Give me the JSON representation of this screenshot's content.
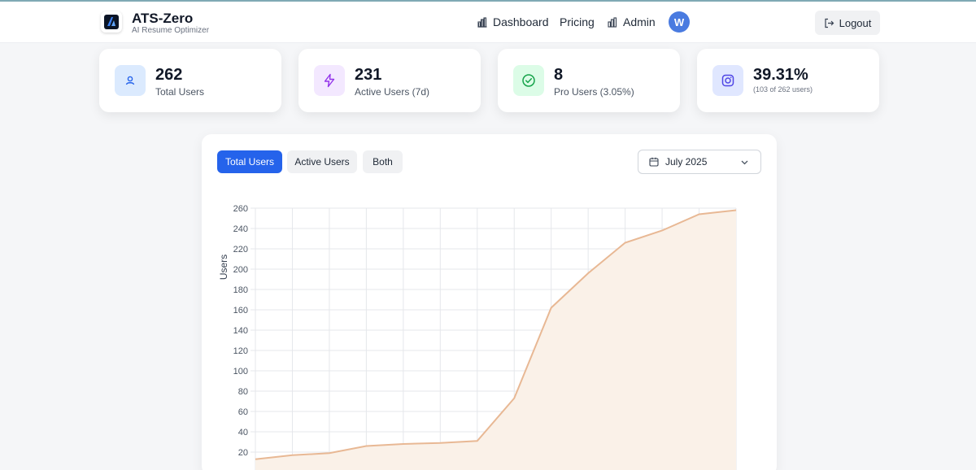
{
  "header": {
    "brand_title": "ATS-Zero",
    "brand_subtitle": "AI Resume Optimizer",
    "nav": [
      {
        "label": "Dashboard",
        "icon": "bar-chart-icon"
      },
      {
        "label": "Pricing"
      },
      {
        "label": "Admin",
        "icon": "bar-chart-icon"
      }
    ],
    "avatar_initial": "W",
    "logout_label": "Logout"
  },
  "stats": [
    {
      "value": "262",
      "label": "Total Users",
      "icon": "user-icon",
      "icon_color": "#2563eb",
      "icon_bg": "#dbeafe"
    },
    {
      "value": "231",
      "label": "Active Users (7d)",
      "icon": "lightning-icon",
      "icon_color": "#9333ea",
      "icon_bg": "#f3e8ff"
    },
    {
      "value": "8",
      "label": "Pro Users (3.05%)",
      "icon": "check-circle-icon",
      "icon_color": "#16a34a",
      "icon_bg": "#dcfce7"
    },
    {
      "value": "39.31%",
      "label": "(103 of 262 users)",
      "icon": "instagram-icon",
      "icon_color": "#4f46e5",
      "icon_bg": "#e0e7ff"
    }
  ],
  "chart_panel": {
    "tabs": [
      "Total Users",
      "Active Users",
      "Both"
    ],
    "active_tab": "Total Users",
    "month": "July 2025"
  },
  "chart_data": {
    "type": "area",
    "ylabel": "Users",
    "xlabel": "",
    "ylim": [
      0,
      260
    ],
    "yticks": [
      20,
      40,
      60,
      80,
      100,
      120,
      140,
      160,
      180,
      200,
      220,
      240,
      260
    ],
    "grid": true,
    "series": [
      {
        "values": [
          13,
          17,
          19,
          26,
          28,
          29,
          31,
          73,
          162,
          196,
          226,
          238,
          254,
          258
        ],
        "color": "#e8b894",
        "fill": "#faf1e8"
      }
    ]
  }
}
